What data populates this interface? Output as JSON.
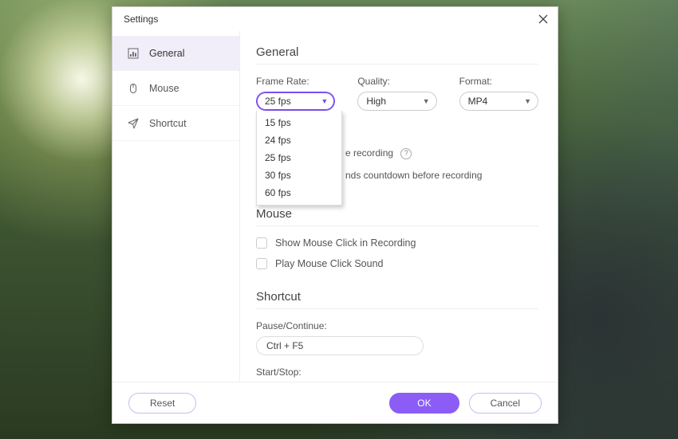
{
  "dialog": {
    "title": "Settings"
  },
  "sidebar": {
    "items": [
      {
        "label": "General"
      },
      {
        "label": "Mouse"
      },
      {
        "label": "Shortcut"
      }
    ]
  },
  "general": {
    "heading": "General",
    "frame_rate": {
      "label": "Frame Rate:",
      "value": "25 fps",
      "options": [
        "15 fps",
        "24 fps",
        "25 fps",
        "30 fps",
        "60 fps"
      ]
    },
    "quality": {
      "label": "Quality:",
      "value": "High"
    },
    "format": {
      "label": "Format:",
      "value": "MP4"
    },
    "line1_suffix": "e recording",
    "line2_suffix": "nds countdown before recording"
  },
  "mouse": {
    "heading": "Mouse",
    "show_click_label": "Show Mouse Click in Recording",
    "play_sound_label": "Play Mouse Click Sound"
  },
  "shortcut": {
    "heading": "Shortcut",
    "pause_label": "Pause/Continue:",
    "pause_value": "Ctrl + F5",
    "startstop_label": "Start/Stop:"
  },
  "footer": {
    "reset": "Reset",
    "ok": "OK",
    "cancel": "Cancel"
  }
}
